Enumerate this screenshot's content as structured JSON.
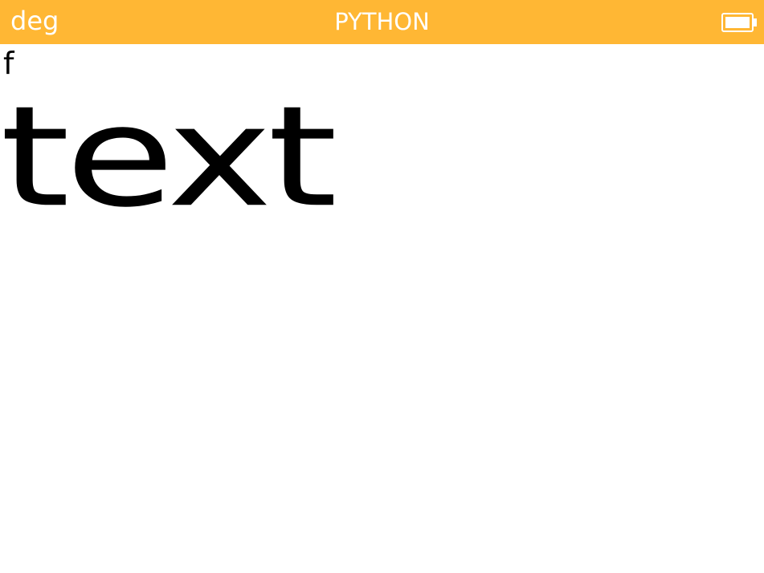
{
  "status_bar": {
    "angle_mode": "deg",
    "app_title": "PYTHON",
    "battery_icon": "battery-full-icon",
    "background_color": "#ffb734",
    "text_color": "#ffffff"
  },
  "console": {
    "line_1": "f",
    "big_text": "text"
  }
}
